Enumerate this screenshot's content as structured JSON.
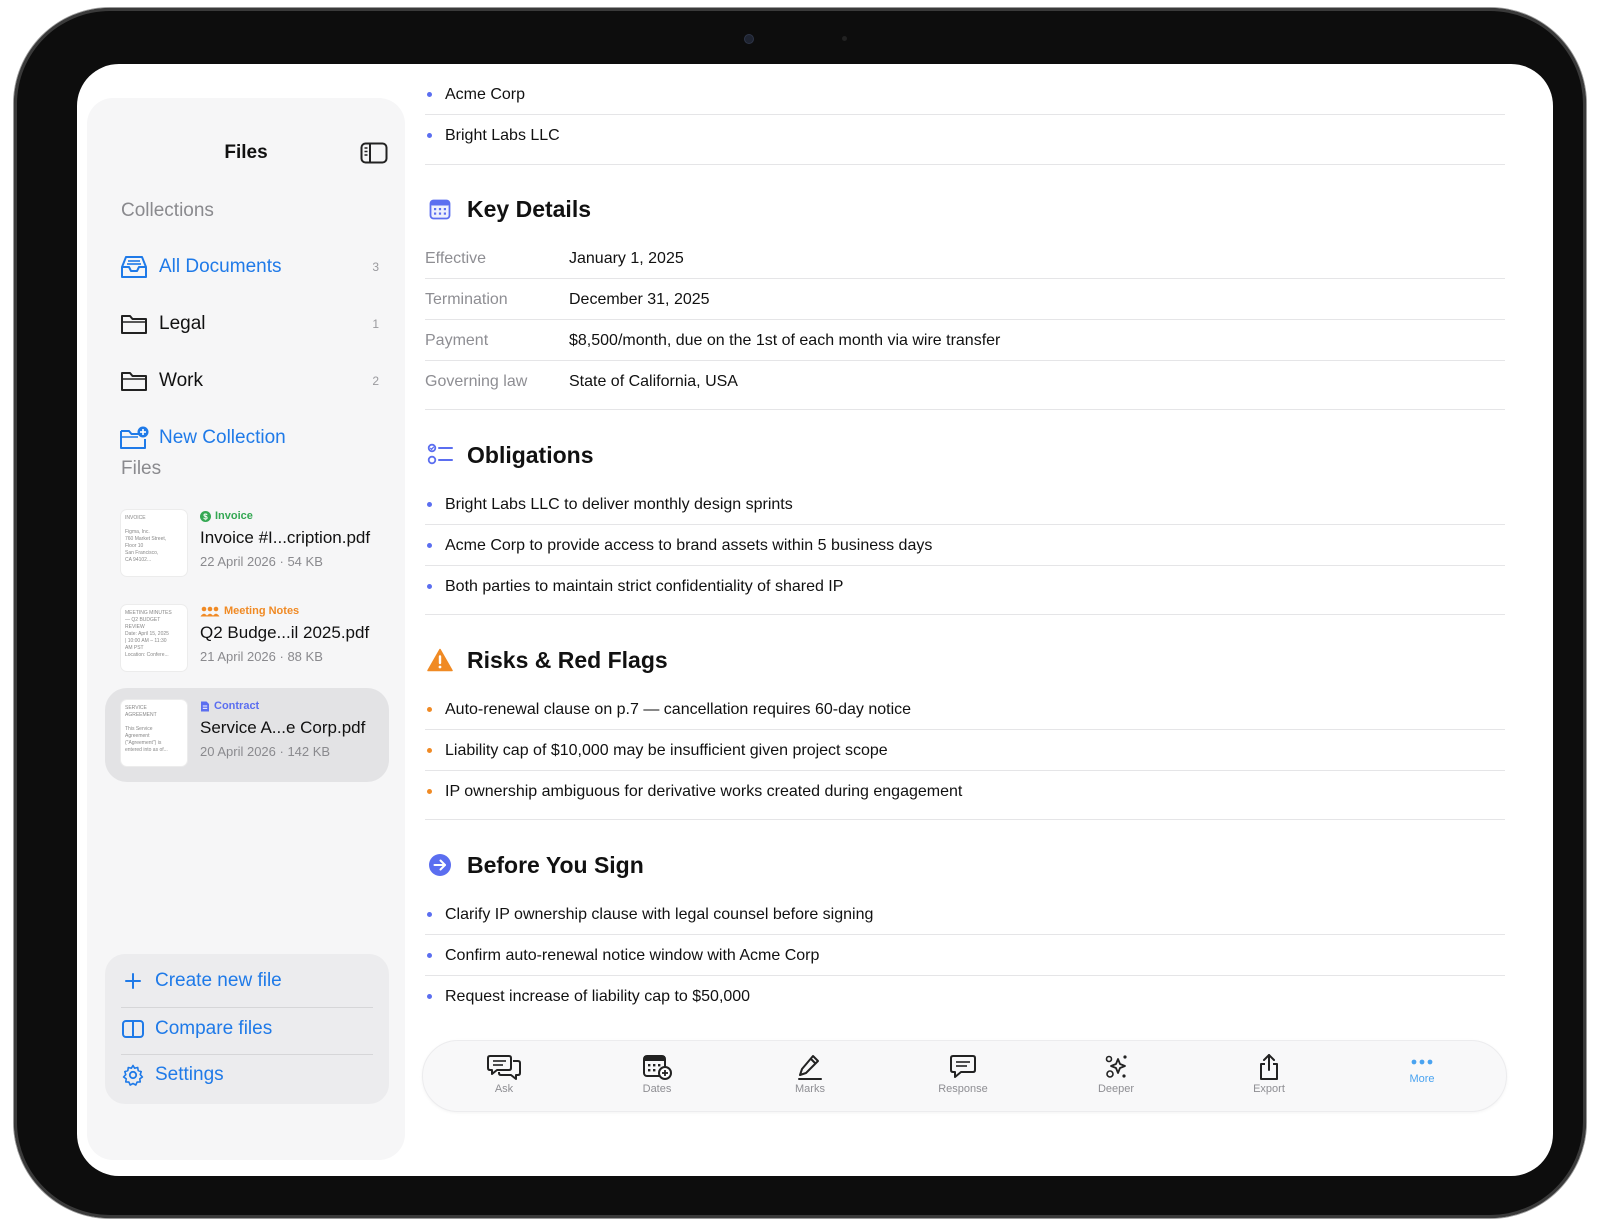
{
  "sidebar": {
    "title": "Files",
    "collections_heading": "Collections",
    "collections": [
      {
        "label": "All Documents",
        "count": "3",
        "icon": "tray-icon"
      },
      {
        "label": "Legal",
        "count": "1",
        "icon": "folder-icon"
      },
      {
        "label": "Work",
        "count": "2",
        "icon": "folder-icon"
      }
    ],
    "new_collection_label": "New Collection",
    "files_heading": "Files",
    "files": [
      {
        "tag": "Invoice",
        "tag_color": "#34a853",
        "name": "Invoice #I...cription.pdf",
        "meta": "22 April 2026 · 54 KB",
        "thumb": [
          "INVOICE",
          "",
          "Figma, Inc.",
          "760 Market Street,",
          "Floor 10",
          "San Francisco,",
          "CA 94102..."
        ]
      },
      {
        "tag": "Meeting Notes",
        "tag_color": "#f08a24",
        "name": "Q2 Budge...il 2025.pdf",
        "meta": "21 April 2026 · 88 KB",
        "thumb": [
          "MEETING MINUTES",
          "— Q2 BUDGET",
          "REVIEW",
          "Date: April 15, 2025",
          "| 10:00 AM – 11:30",
          "AM PST",
          "Location: Confere..."
        ]
      },
      {
        "tag": "Contract",
        "tag_color": "#5b6ef0",
        "name": "Service A...e Corp.pdf",
        "meta": "20 April 2026 · 142 KB",
        "thumb": [
          "SERVICE",
          "AGREEMENT",
          "",
          "This Service",
          "Agreement",
          "(\"Agreement\") is",
          "entered into as of..."
        ]
      }
    ],
    "actions": {
      "create": "Create new file",
      "compare": "Compare files",
      "settings": "Settings"
    }
  },
  "main": {
    "parties": [
      "Acme Corp",
      "Bright Labs LLC"
    ],
    "key_details": {
      "title": "Key Details",
      "rows": [
        {
          "k": "Effective",
          "v": "January 1, 2025"
        },
        {
          "k": "Termination",
          "v": "December 31, 2025"
        },
        {
          "k": "Payment",
          "v": "$8,500/month, due on the 1st of each month via wire transfer"
        },
        {
          "k": "Governing law",
          "v": "State of California, USA"
        }
      ]
    },
    "obligations": {
      "title": "Obligations",
      "items": [
        "Bright Labs LLC to deliver monthly design sprints",
        "Acme Corp to provide access to brand assets within 5 business days",
        "Both parties to maintain strict confidentiality of shared IP"
      ]
    },
    "risks": {
      "title": "Risks & Red Flags",
      "items": [
        "Auto-renewal clause on p.7 — cancellation requires 60-day notice",
        "Liability cap of $10,000 may be insufficient given project scope",
        "IP ownership ambiguous for derivative works created during engagement"
      ]
    },
    "before_sign": {
      "title": "Before You Sign",
      "items": [
        "Clarify IP ownership clause with legal counsel before signing",
        "Confirm auto-renewal notice window with Acme Corp",
        "Request increase of liability cap to $50,000"
      ]
    }
  },
  "toolbar": [
    {
      "label": "Ask",
      "icon": "chat-bubbles-icon"
    },
    {
      "label": "Dates",
      "icon": "calendar-plus-icon"
    },
    {
      "label": "Marks",
      "icon": "pen-icon"
    },
    {
      "label": "Response",
      "icon": "message-icon"
    },
    {
      "label": "Deeper",
      "icon": "sparkles-icon"
    },
    {
      "label": "Export",
      "icon": "share-icon"
    },
    {
      "label": "More",
      "icon": "ellipsis-icon"
    }
  ],
  "colors": {
    "accent": "#1f7ae8",
    "blue_bullet": "#5b6ef0",
    "orange_bullet": "#f08a24",
    "warning": "#f08a24"
  }
}
